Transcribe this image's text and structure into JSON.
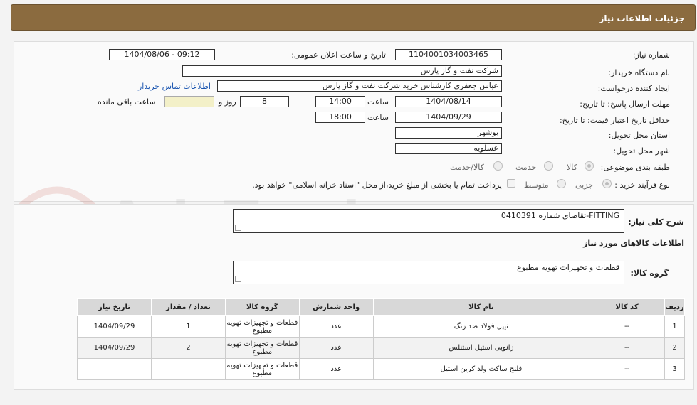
{
  "header": {
    "title": "جزئیات اطلاعات نیاز"
  },
  "form": {
    "need_number": {
      "label": "شماره نیاز:",
      "value": "1104001034003465"
    },
    "announce_datetime": {
      "label": "تاریخ و ساعت اعلان عمومی:",
      "value": "1404/08/06 - 09:12"
    },
    "buyer_org": {
      "label": "نام دستگاه خریدار:",
      "value": "شرکت نفت و گاز پارس"
    },
    "requester": {
      "label": "ایجاد کننده درخواست:",
      "value": "عباس  جعفری کارشناس خرید  شرکت نفت و گاز پارس",
      "contact_link": "اطلاعات تماس خریدار"
    },
    "response_deadline": {
      "label": "مهلت ارسال پاسخ: تا تاریخ:",
      "date": "1404/08/14",
      "time_label": "ساعت",
      "time": "14:00",
      "days": "8",
      "days_label": "روز و",
      "remaining": "",
      "remaining_label": "ساعت باقی مانده"
    },
    "price_validity": {
      "label": "حداقل تاریخ اعتبار قیمت: تا تاریخ:",
      "date": "1404/09/29",
      "time_label": "ساعت",
      "time": "18:00"
    },
    "province": {
      "label": "استان محل تحویل:",
      "value": "بوشهر"
    },
    "city": {
      "label": "شهر محل تحویل:",
      "value": "عسلویه"
    },
    "category": {
      "label": "طبقه بندی موضوعی:",
      "options": [
        "کالا",
        "خدمت",
        "کالا/خدمت"
      ],
      "selected": "کالا"
    },
    "purchase_type": {
      "label": "نوع فرآیند خرید :",
      "options": [
        "جزیی",
        "متوسط"
      ],
      "selected": "جزیی",
      "note": "پرداخت تمام یا بخشی از مبلغ خرید،از محل \"اسناد خزانه اسلامی\" خواهد بود."
    }
  },
  "description": {
    "label": "شرح کلی نیاز:",
    "value": "FITTING-تقاضای شماره 0410391"
  },
  "goods_section": {
    "title": "اطلاعات کالاهای مورد نیاز",
    "group_label": "گروه کالا:",
    "group_value": "قطعات و تجهیزات تهویه مطبوع"
  },
  "table": {
    "headers": [
      "ردیف",
      "کد کالا",
      "نام کالا",
      "واحد شمارش",
      "گروه کالا",
      "تعداد / مقدار",
      "تاریخ نیاز"
    ],
    "rows": [
      [
        "1",
        "--",
        "نیپل فولاد ضد زنگ",
        "عدد",
        "قطعات و تجهیزات تهویه مطبوع",
        "1",
        "1404/09/29"
      ],
      [
        "2",
        "--",
        "زانویی استیل استنلس",
        "عدد",
        "قطعات و تجهیزات تهویه مطبوع",
        "2",
        "1404/09/29"
      ],
      [
        "3",
        "--",
        "فلنج ساکت ولد کربن استیل",
        "عدد",
        "قطعات و تجهیزات تهویه مطبوع",
        "",
        ""
      ]
    ]
  },
  "watermark": {
    "text": "AriaTender.neT"
  }
}
